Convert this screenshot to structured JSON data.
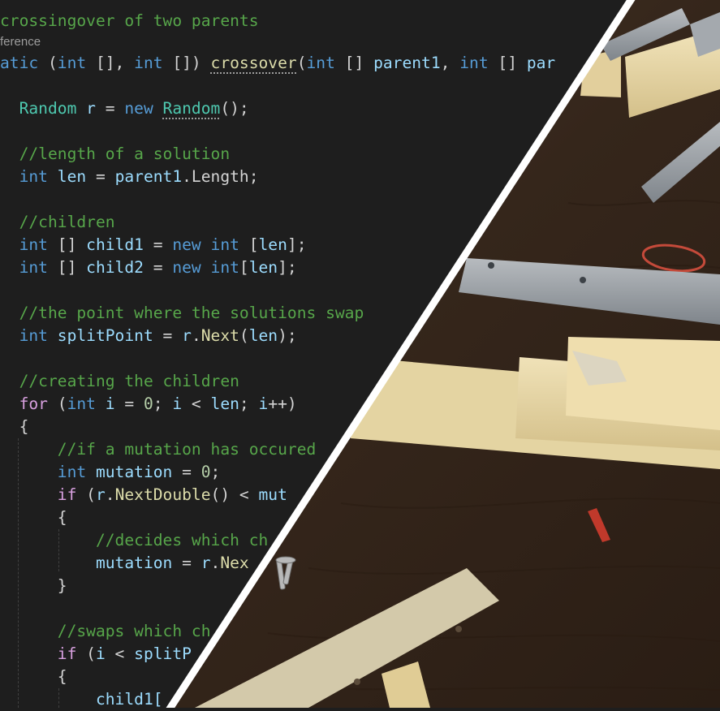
{
  "code": {
    "lines": [
      {
        "segments": [
          {
            "t": "crossingover of two parents",
            "c": "comment"
          }
        ]
      },
      {
        "codelens": "ference"
      },
      {
        "segments": [
          {
            "t": "atic",
            "c": "kw"
          },
          {
            "t": " (",
            "c": "punc"
          },
          {
            "t": "int",
            "c": "kw"
          },
          {
            "t": " [], ",
            "c": "punc"
          },
          {
            "t": "int",
            "c": "kw"
          },
          {
            "t": " []) ",
            "c": "punc"
          },
          {
            "t": "crossover",
            "c": "fn",
            "squig": true
          },
          {
            "t": "(",
            "c": "punc"
          },
          {
            "t": "int",
            "c": "kw"
          },
          {
            "t": " [] ",
            "c": "punc"
          },
          {
            "t": "parent1",
            "c": "var"
          },
          {
            "t": ", ",
            "c": "punc"
          },
          {
            "t": "int",
            "c": "kw"
          },
          {
            "t": " [] ",
            "c": "punc"
          },
          {
            "t": "par",
            "c": "var"
          }
        ]
      },
      {
        "segments": []
      },
      {
        "segments": [
          {
            "t": "  "
          },
          {
            "t": "Random",
            "c": "type"
          },
          {
            "t": " ",
            "c": "punc"
          },
          {
            "t": "r",
            "c": "var"
          },
          {
            "t": " = ",
            "c": "punc"
          },
          {
            "t": "new",
            "c": "kw"
          },
          {
            "t": " ",
            "c": "punc"
          },
          {
            "t": "Random",
            "c": "type",
            "squig": true
          },
          {
            "t": "();",
            "c": "punc"
          }
        ]
      },
      {
        "segments": []
      },
      {
        "segments": [
          {
            "t": "  "
          },
          {
            "t": "//length of a solution",
            "c": "comment"
          }
        ]
      },
      {
        "segments": [
          {
            "t": "  "
          },
          {
            "t": "int",
            "c": "kw"
          },
          {
            "t": " ",
            "c": "punc"
          },
          {
            "t": "len",
            "c": "var"
          },
          {
            "t": " = ",
            "c": "punc"
          },
          {
            "t": "parent1",
            "c": "var"
          },
          {
            "t": ".Length;",
            "c": "punc"
          }
        ]
      },
      {
        "segments": []
      },
      {
        "segments": [
          {
            "t": "  "
          },
          {
            "t": "//children",
            "c": "comment"
          }
        ]
      },
      {
        "segments": [
          {
            "t": "  "
          },
          {
            "t": "int",
            "c": "kw"
          },
          {
            "t": " [] ",
            "c": "punc"
          },
          {
            "t": "child1",
            "c": "var"
          },
          {
            "t": " = ",
            "c": "punc"
          },
          {
            "t": "new",
            "c": "kw"
          },
          {
            "t": " ",
            "c": "punc"
          },
          {
            "t": "int",
            "c": "kw"
          },
          {
            "t": " [",
            "c": "punc"
          },
          {
            "t": "len",
            "c": "var"
          },
          {
            "t": "];",
            "c": "punc"
          }
        ]
      },
      {
        "segments": [
          {
            "t": "  "
          },
          {
            "t": "int",
            "c": "kw"
          },
          {
            "t": " [] ",
            "c": "punc"
          },
          {
            "t": "child2",
            "c": "var"
          },
          {
            "t": " = ",
            "c": "punc"
          },
          {
            "t": "new",
            "c": "kw"
          },
          {
            "t": " ",
            "c": "punc"
          },
          {
            "t": "int",
            "c": "kw"
          },
          {
            "t": "[",
            "c": "punc"
          },
          {
            "t": "len",
            "c": "var"
          },
          {
            "t": "];",
            "c": "punc"
          }
        ]
      },
      {
        "segments": []
      },
      {
        "segments": [
          {
            "t": "  "
          },
          {
            "t": "//the point where the solutions swap",
            "c": "comment"
          }
        ]
      },
      {
        "segments": [
          {
            "t": "  "
          },
          {
            "t": "int",
            "c": "kw"
          },
          {
            "t": " ",
            "c": "punc"
          },
          {
            "t": "splitPoint",
            "c": "var"
          },
          {
            "t": " = ",
            "c": "punc"
          },
          {
            "t": "r",
            "c": "var"
          },
          {
            "t": ".",
            "c": "punc"
          },
          {
            "t": "Next",
            "c": "fn"
          },
          {
            "t": "(",
            "c": "punc"
          },
          {
            "t": "len",
            "c": "var"
          },
          {
            "t": ");",
            "c": "punc"
          }
        ]
      },
      {
        "segments": []
      },
      {
        "segments": [
          {
            "t": "  "
          },
          {
            "t": "//creating the children",
            "c": "comment"
          }
        ]
      },
      {
        "segments": [
          {
            "t": "  "
          },
          {
            "t": "for",
            "c": "ctrl"
          },
          {
            "t": " (",
            "c": "punc"
          },
          {
            "t": "int",
            "c": "kw"
          },
          {
            "t": " ",
            "c": "punc"
          },
          {
            "t": "i",
            "c": "var"
          },
          {
            "t": " = ",
            "c": "punc"
          },
          {
            "t": "0",
            "c": "num"
          },
          {
            "t": "; ",
            "c": "punc"
          },
          {
            "t": "i",
            "c": "var"
          },
          {
            "t": " < ",
            "c": "punc"
          },
          {
            "t": "len",
            "c": "var"
          },
          {
            "t": "; ",
            "c": "punc"
          },
          {
            "t": "i",
            "c": "var"
          },
          {
            "t": "++)",
            "c": "punc"
          }
        ]
      },
      {
        "segments": [
          {
            "t": "  "
          },
          {
            "t": "{",
            "c": "punc"
          }
        ]
      },
      {
        "segments": [
          {
            "t": "      "
          },
          {
            "t": "//if a mutation has occured",
            "c": "comment"
          }
        ]
      },
      {
        "segments": [
          {
            "t": "      "
          },
          {
            "t": "int",
            "c": "kw"
          },
          {
            "t": " ",
            "c": "punc"
          },
          {
            "t": "mutation",
            "c": "var"
          },
          {
            "t": " = ",
            "c": "punc"
          },
          {
            "t": "0",
            "c": "num"
          },
          {
            "t": ";",
            "c": "punc"
          }
        ]
      },
      {
        "segments": [
          {
            "t": "      "
          },
          {
            "t": "if",
            "c": "ctrl"
          },
          {
            "t": " (",
            "c": "punc"
          },
          {
            "t": "r",
            "c": "var"
          },
          {
            "t": ".",
            "c": "punc"
          },
          {
            "t": "NextDouble",
            "c": "fn"
          },
          {
            "t": "() < ",
            "c": "punc"
          },
          {
            "t": "mut",
            "c": "var"
          }
        ]
      },
      {
        "segments": [
          {
            "t": "      "
          },
          {
            "t": "{",
            "c": "punc"
          }
        ]
      },
      {
        "segments": [
          {
            "t": "          "
          },
          {
            "t": "//decides which ch",
            "c": "comment"
          }
        ]
      },
      {
        "segments": [
          {
            "t": "          "
          },
          {
            "t": "mutation",
            "c": "var"
          },
          {
            "t": " = ",
            "c": "punc"
          },
          {
            "t": "r",
            "c": "var"
          },
          {
            "t": ".",
            "c": "punc"
          },
          {
            "t": "Nex",
            "c": "fn"
          }
        ]
      },
      {
        "segments": [
          {
            "t": "      "
          },
          {
            "t": "}",
            "c": "punc"
          }
        ]
      },
      {
        "segments": []
      },
      {
        "segments": [
          {
            "t": "      "
          },
          {
            "t": "//swaps which ch",
            "c": "comment"
          }
        ]
      },
      {
        "segments": [
          {
            "t": "      "
          },
          {
            "t": "if",
            "c": "ctrl"
          },
          {
            "t": " (",
            "c": "punc"
          },
          {
            "t": "i",
            "c": "var"
          },
          {
            "t": " < ",
            "c": "punc"
          },
          {
            "t": "splitP",
            "c": "var"
          }
        ]
      },
      {
        "segments": [
          {
            "t": "      "
          },
          {
            "t": "{",
            "c": "punc"
          }
        ]
      },
      {
        "segments": [
          {
            "t": "          "
          },
          {
            "t": "child1[",
            "c": "var"
          }
        ]
      }
    ]
  },
  "colors": {
    "editor_bg": "#1e1e1e",
    "divider": "#ffffff",
    "table_wood": "#3a2a1e",
    "light_wood": "#e8d9a8",
    "grey_plastic": "#9ea3a8",
    "rubber_band": "#c44a3a"
  },
  "photo": {
    "objects": [
      "wooden-table",
      "wooden-board",
      "grey-channel-piece",
      "rubber-band",
      "screws",
      "red-drill-bit"
    ]
  }
}
